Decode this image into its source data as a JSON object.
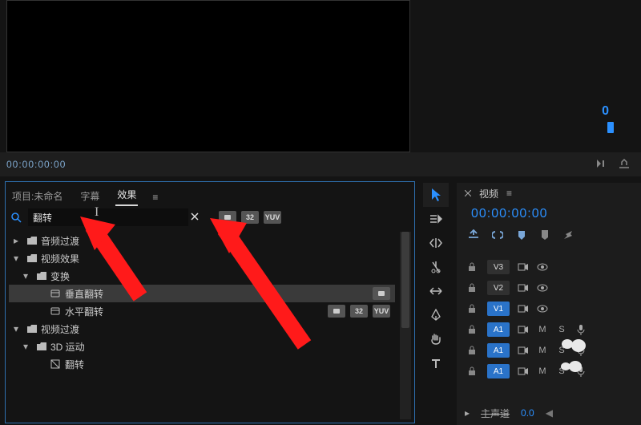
{
  "viewer": {
    "timecode": "00:00:00:00",
    "marker": "0"
  },
  "effects": {
    "tabs": {
      "project": "项目:未命名",
      "subs": "字幕",
      "fx": "效果"
    },
    "search": {
      "placeholder": "",
      "value": "翻转"
    },
    "filter_badges": [
      "",
      "32",
      "YUV"
    ],
    "tree": {
      "n0": "音频过渡",
      "n1": "视频效果",
      "n2": "变换",
      "n3": "垂直翻转",
      "n4": "水平翻转",
      "n5": "视频过渡",
      "n6": "3D 运动",
      "n7": "翻转"
    }
  },
  "timeline": {
    "title": "视频",
    "timecode": "00:00:00:00",
    "tracks": {
      "v3": "V3",
      "v2": "V2",
      "v1": "V1",
      "a1": "A1",
      "a2": "A1",
      "a3": "A1",
      "m": "M",
      "s": "S"
    },
    "footer": {
      "master": "主声道",
      "val": "0.0"
    }
  }
}
